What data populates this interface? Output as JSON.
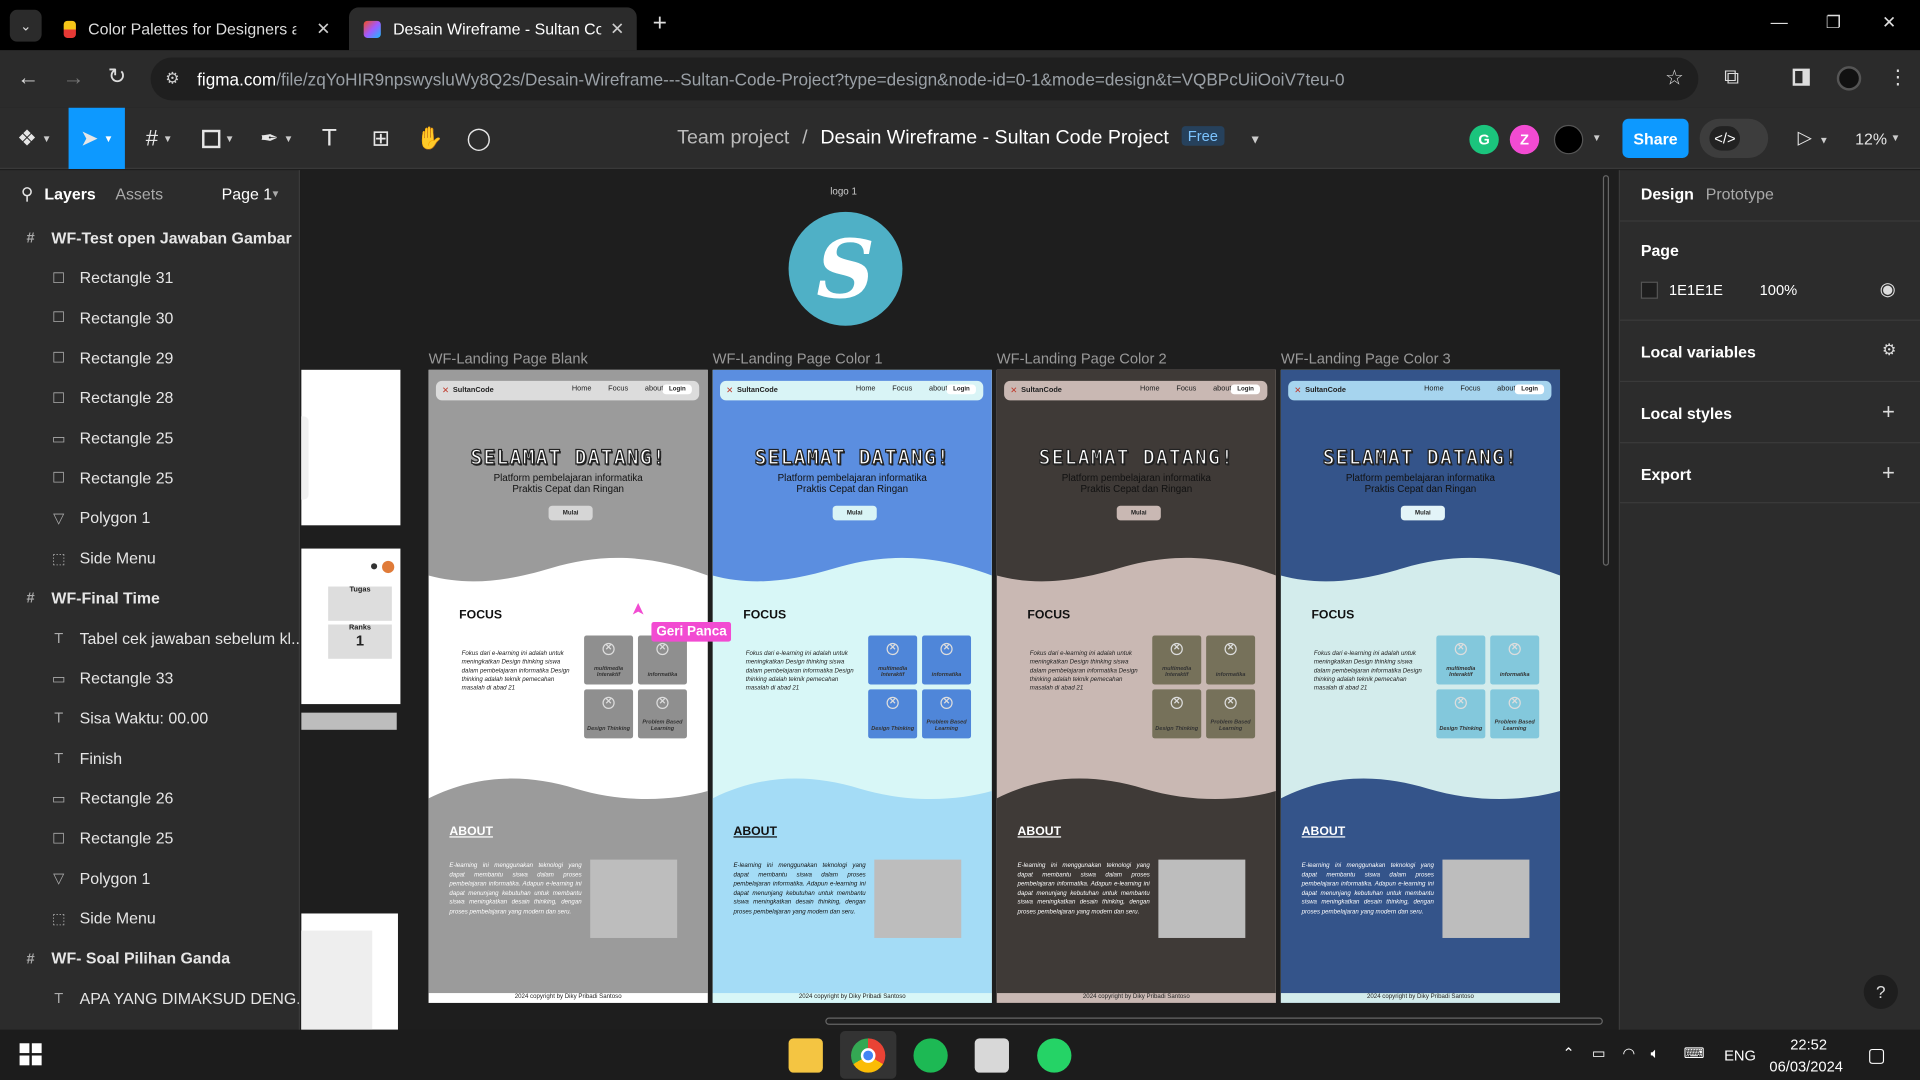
{
  "browser": {
    "tabs": [
      {
        "title": "Color Palettes for Designers and"
      },
      {
        "title": "Desain Wireframe - Sultan Code"
      }
    ],
    "new_tab": "+",
    "url_host": "figma.com",
    "url_path": "/file/zqYoHIR9npswysluWy8Q2s/Desain-Wireframe---Sultan-Code-Project?type=design&node-id=0-1&mode=design&t=VQBPcUiiOoiV7teu-0"
  },
  "figma": {
    "breadcrumb_team": "Team project",
    "separator": "/",
    "doc_title": "Desain Wireframe - Sultan Code Project",
    "plan_badge": "Free",
    "avatars": [
      {
        "letter": "G",
        "color": "#1bc47d"
      },
      {
        "letter": "Z",
        "color": "#f24bd2"
      }
    ],
    "share_label": "Share",
    "zoom": "12%",
    "text_tool": "T"
  },
  "left_panel": {
    "tab_layers": "Layers",
    "tab_assets": "Assets",
    "page_selector": "Page 1",
    "layers": [
      {
        "kind": "frame",
        "name": "WF-Test open Jawaban Gambar"
      },
      {
        "kind": "rect",
        "name": "Rectangle 31"
      },
      {
        "kind": "rect",
        "name": "Rectangle 30"
      },
      {
        "kind": "rect",
        "name": "Rectangle 29"
      },
      {
        "kind": "rect",
        "name": "Rectangle 28"
      },
      {
        "kind": "line",
        "name": "Rectangle 25"
      },
      {
        "kind": "rect",
        "name": "Rectangle 25"
      },
      {
        "kind": "polygon",
        "name": "Polygon 1"
      },
      {
        "kind": "group",
        "name": "Side Menu"
      },
      {
        "kind": "frame",
        "name": "WF-Final Time"
      },
      {
        "kind": "text",
        "name": "Tabel cek jawaban sebelum kl..."
      },
      {
        "kind": "line",
        "name": "Rectangle 33"
      },
      {
        "kind": "text",
        "name": "Sisa Waktu: 00.00"
      },
      {
        "kind": "text",
        "name": "Finish"
      },
      {
        "kind": "line",
        "name": "Rectangle 26"
      },
      {
        "kind": "rect",
        "name": "Rectangle 25"
      },
      {
        "kind": "polygon",
        "name": "Polygon 1"
      },
      {
        "kind": "group",
        "name": "Side Menu"
      },
      {
        "kind": "frame",
        "name": "WF- Soal Pilihan Ganda"
      },
      {
        "kind": "text",
        "name": "APA YANG DIMAKSUD DENG..."
      }
    ]
  },
  "canvas": {
    "logo_label": "logo 1",
    "cursor_user": "Geri Panca",
    "left_thumb": {
      "tugas": "Tugas",
      "ranks": "Ranks",
      "rank_value": "1"
    },
    "pages": [
      {
        "label": "WF-Landing Page Blank",
        "top": "#9b9b9b",
        "middle": "#ffffff",
        "bottom": "#9b9b9b",
        "nav": "#dcdcdc",
        "card": "#8f8f8f",
        "button": "#d6d6d6"
      },
      {
        "label": "WF-Landing Page Color 1",
        "top": "#5b8ee0",
        "middle": "#d8f7f7",
        "bottom": "#a4dcf6",
        "nav": "#d9f4f6",
        "card": "#4f86d9",
        "button": "#d9f4f6"
      },
      {
        "label": "WF-Landing Page Color 2",
        "top": "#3f3a37",
        "middle": "#c9b8b3",
        "bottom": "#3f3a37",
        "nav": "#c9b8b3",
        "card": "#76715a",
        "button": "#c9b8b3"
      },
      {
        "label": "WF-Landing Page Color 3",
        "top": "#34548a",
        "middle": "#d3ecec",
        "bottom": "#34548a",
        "nav": "#a6d4ee",
        "card": "#83c8dc",
        "button": "#e3f4f8"
      }
    ],
    "page_content": {
      "brand": "SultanCode",
      "nav_links": "Home Focus about",
      "login": "Login",
      "hero_title": "SELAMAT DATANG!",
      "hero_sub1": "Platform pembelajaran informatika",
      "hero_sub2": "Praktis Cepat dan Ringan",
      "button": "Mulai",
      "focus_title": "FOCUS",
      "focus_text": "Fokus dari e-learning ini adalah untuk meningkatkan Design thinking siswa dalam pembelajaran informatika Design thinking adalah teknik pemecahan masalah di abad 21",
      "cards": [
        "multimedia Interaktif",
        "informatika",
        "Design Thinking",
        "Problem Based Learning"
      ],
      "about_title": "ABOUT",
      "about_text": "E-learning ini menggunakan teknologi yang dapat membantu siswa dalam proses pembelajaran informatika. Adapun e-learning ini dapat menunjang kebutuhan untuk membantu siswa meningkatkan desain thinking, dengan proses pembelajaran yang modern dan seru.",
      "copyright": "2024 copyright by Diky Pribadi Santoso"
    }
  },
  "right_panel": {
    "tab_design": "Design",
    "tab_prototype": "Prototype",
    "page_section": "Page",
    "page_color": "1E1E1E",
    "page_opacity": "100%",
    "local_variables": "Local variables",
    "local_styles": "Local styles",
    "export": "Export",
    "help": "?"
  },
  "taskbar": {
    "language": "ENG",
    "time": "22:52",
    "date": "06/03/2024"
  }
}
